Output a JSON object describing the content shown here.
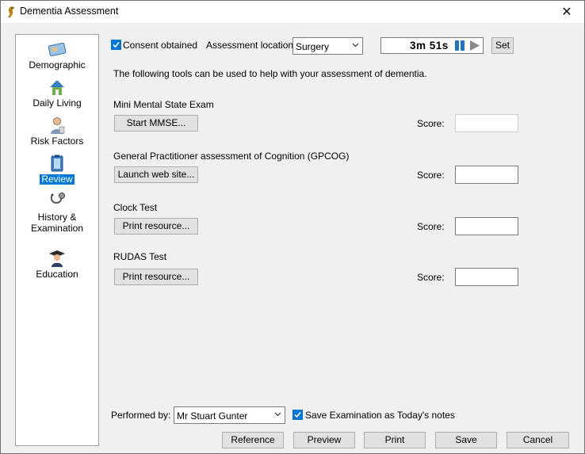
{
  "window": {
    "title": "Dementia Assessment",
    "close_glyph": "✕"
  },
  "sidebar": {
    "items": [
      {
        "label": "Demographic",
        "icon": "card-icon"
      },
      {
        "label": "Daily Living",
        "icon": "house-icon"
      },
      {
        "label": "Risk Factors",
        "icon": "person-icon"
      },
      {
        "label": "Review",
        "icon": "clipboard-icon",
        "active": true
      },
      {
        "label": "History &",
        "label2": "Examination",
        "icon": "stethoscope-icon"
      },
      {
        "label": "Education",
        "icon": "graduate-icon"
      }
    ]
  },
  "header": {
    "consent_label": "Consent obtained",
    "consent_checked": true,
    "location_label": "Assessment location:",
    "location_value": "Surgery",
    "timer_value": "3m  51s",
    "set_label": "Set"
  },
  "intro": "The following tools can be used to help with your assessment of dementia.",
  "tools": [
    {
      "title": "Mini Mental State Exam",
      "button": "Start MMSE...",
      "score_label": "Score:",
      "score": "",
      "enabled": false
    },
    {
      "title": "General Practitioner assessment of Cognition (GPCOG)",
      "button": "Launch web site...",
      "score_label": "Score:",
      "score": "",
      "enabled": true
    },
    {
      "title": "Clock Test",
      "button": "Print resource...",
      "score_label": "Score:",
      "score": "",
      "enabled": true
    },
    {
      "title": "RUDAS Test",
      "button": "Print resource...",
      "score_label": "Score:",
      "score": "",
      "enabled": true
    }
  ],
  "footer": {
    "performed_by_label": "Performed by:",
    "performed_by_value": "Mr Stuart Gunter",
    "save_notes_label": "Save Examination as Today's notes",
    "save_notes_checked": true,
    "buttons": {
      "reference": "Reference",
      "preview": "Preview",
      "print": "Print",
      "save": "Save",
      "cancel": "Cancel"
    }
  },
  "colors": {
    "accent": "#0078d7",
    "window_bg": "#f0f0f0",
    "pause_blue": "#1e73c8",
    "play_gray": "#8a8a8a"
  }
}
